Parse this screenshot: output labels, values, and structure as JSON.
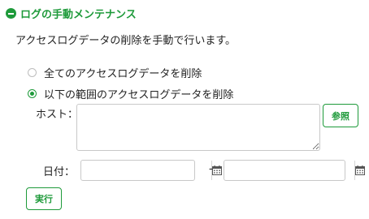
{
  "section": {
    "title": "ログの手動メンテナンス"
  },
  "description": "アクセスログデータの削除を手動で行います。",
  "options": [
    {
      "label": "全てのアクセスログデータを削除",
      "checked": false
    },
    {
      "label": "以下の範囲のアクセスログデータを削除",
      "checked": true
    }
  ],
  "host": {
    "label": "ホスト：",
    "value": "",
    "browse_label": "参照"
  },
  "date": {
    "label": "日付：",
    "from_value": "",
    "to_value": "",
    "separator": "-"
  },
  "execute_label": "実行",
  "colors": {
    "accent": "#1e9a3a",
    "border": "#c8c8c8"
  }
}
